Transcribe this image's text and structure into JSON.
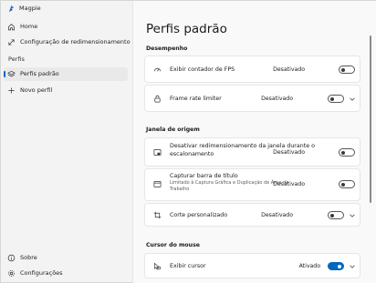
{
  "window": {
    "title": "Magpie"
  },
  "sidebar": {
    "items": [
      {
        "label": "Home",
        "icon": "home-icon"
      },
      {
        "label": "Configuração de redimensionamento",
        "icon": "resize-icon"
      }
    ],
    "section_label": "Perfis",
    "profiles": [
      {
        "label": "Perfis padrão",
        "icon": "layers-icon",
        "selected": true
      },
      {
        "label": "Novo perfil",
        "icon": "plus-icon"
      }
    ],
    "footer": [
      {
        "label": "Sobre",
        "icon": "info-icon"
      },
      {
        "label": "Configurações",
        "icon": "gear-icon"
      }
    ]
  },
  "main": {
    "title": "Perfis padrão",
    "groups": [
      {
        "header": "Desempenho",
        "rows": [
          {
            "label": "Exibir contador de FPS",
            "state": "Desativado",
            "on": false,
            "icon": "speedometer-icon",
            "chevron": false
          },
          {
            "label": "Frame rate limiter",
            "state": "Desativado",
            "on": false,
            "icon": "lock-icon",
            "chevron": true
          }
        ]
      },
      {
        "header": "Janela de origem",
        "rows": [
          {
            "label": "Desativar redimensionamento da janela durante o escalonamento",
            "state": "Desativado",
            "on": false,
            "icon": "window-lock-icon",
            "chevron": false
          },
          {
            "label": "Capturar barra de título",
            "sub": "Limitado à Captura Gráfica e Duplicação de Área de Trabalho",
            "state": "Desativado",
            "on": false,
            "icon": "window-icon",
            "chevron": false
          },
          {
            "label": "Corte personalizado",
            "state": "Desativado",
            "on": false,
            "icon": "crop-icon",
            "chevron": true
          }
        ]
      },
      {
        "header": "Cursor do mouse",
        "rows": [
          {
            "label": "Exibir cursor",
            "state": "Ativado",
            "on": true,
            "icon": "cursor-icon",
            "chevron": true
          }
        ]
      }
    ]
  },
  "colors": {
    "accent": "#0067c0",
    "card": "#ffffff",
    "pane": "#f9f9f9",
    "sidebar": "#f3f3f3"
  }
}
